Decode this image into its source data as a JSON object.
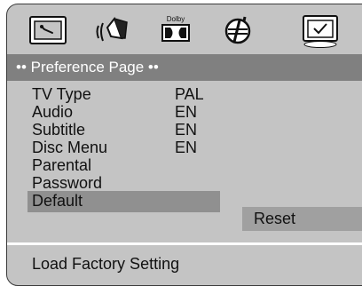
{
  "toolbar": {
    "icons": [
      {
        "name": "general-setup-icon"
      },
      {
        "name": "audio-setup-icon"
      },
      {
        "name": "dolby-setup-icon",
        "label": "Dolby"
      },
      {
        "name": "video-setup-icon"
      },
      {
        "name": "preference-setup-icon",
        "selected": true
      }
    ]
  },
  "header": {
    "title": "•• Preference Page ••"
  },
  "menu": {
    "items": [
      {
        "label": "TV Type",
        "value": "PAL"
      },
      {
        "label": "Audio",
        "value": "EN"
      },
      {
        "label": "Subtitle",
        "value": "EN"
      },
      {
        "label": "Disc Menu",
        "value": "EN"
      },
      {
        "label": "Parental",
        "value": ""
      },
      {
        "label": "Password",
        "value": ""
      },
      {
        "label": "Default",
        "value": "",
        "selected": true
      }
    ]
  },
  "submenu": {
    "option": "Reset"
  },
  "footer": {
    "description": "Load Factory Setting"
  },
  "colors": {
    "panel": "#c4c4c4",
    "header": "#808080",
    "selection": "#909090",
    "option": "#a0a0a0"
  }
}
